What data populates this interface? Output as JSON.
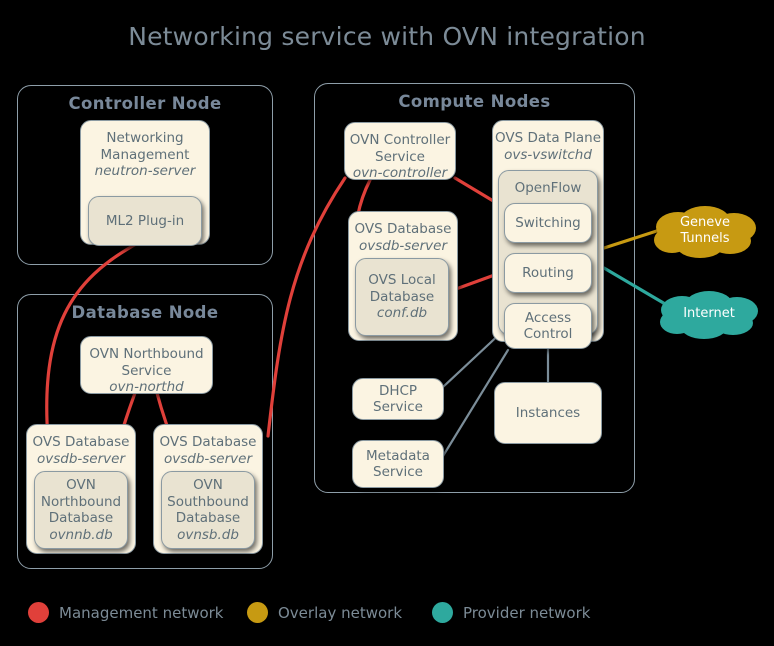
{
  "title": "Networking service with OVN integration",
  "colors": {
    "background": "#000000",
    "title_text": "#7c8b97",
    "group_border": "#8e9ea9",
    "box_fill": "#fbf4e2",
    "box_fill_nested": "#e9e3d1",
    "box_border": "#8b9aa2",
    "box_text": "#5f7079",
    "management_network": "#e0403a",
    "overlay_network": "#c79a12",
    "provider_network": "#2ea99e",
    "plain_link": "#7b8d99"
  },
  "groups": [
    {
      "id": "controller-node",
      "title": "Controller Node"
    },
    {
      "id": "database-node",
      "title": "Database Node"
    },
    {
      "id": "compute-nodes",
      "title": "Compute Nodes"
    }
  ],
  "boxes": {
    "networking_management": {
      "line1": "Networking",
      "line2": "Management",
      "line3": "neutron-server"
    },
    "ml2_plugin": {
      "line1": "ML2 Plug-in"
    },
    "ovn_northbound_service": {
      "line1": "OVN Northbound",
      "line2": "Service",
      "line3": "ovn-northd"
    },
    "ovsdb_nb": {
      "line1": "OVS Database",
      "line2": "ovsdb-server"
    },
    "ovsdb_sb": {
      "line1": "OVS Database",
      "line2": "ovsdb-server"
    },
    "ovn_nb_database": {
      "line1": "OVN",
      "line2": "Northbound",
      "line3": "Database",
      "line4": "ovnnb.db"
    },
    "ovn_sb_database": {
      "line1": "OVN",
      "line2": "Southbound",
      "line3": "Database",
      "line4": "ovnsb.db"
    },
    "ovn_controller_service": {
      "line1": "OVN Controller",
      "line2": "Service",
      "line3": "ovn-controller"
    },
    "ovsdb_local": {
      "line1": "OVS Database",
      "line2": "ovsdb-server"
    },
    "ovs_local_database": {
      "line1": "OVS Local",
      "line2": "Database",
      "line3": "conf.db"
    },
    "ovs_data_plane": {
      "line1": "OVS Data Plane",
      "line2": "ovs-vswitchd"
    },
    "openflow": {
      "line1": "OpenFlow"
    },
    "switching": {
      "line1": "Switching"
    },
    "routing": {
      "line1": "Routing"
    },
    "access_control": {
      "line1": "Access",
      "line2": "Control"
    },
    "dhcp_service": {
      "line1": "DHCP Service"
    },
    "metadata_service": {
      "line1": "Metadata",
      "line2": "Service"
    },
    "instances": {
      "line1": "Instances"
    }
  },
  "clouds": {
    "geneve_tunnels": {
      "line1": "Geneve",
      "line2": "Tunnels",
      "color": "#c79a12"
    },
    "internet": {
      "line1": "Internet",
      "color": "#2ea99e"
    }
  },
  "legend": [
    {
      "label": "Management network",
      "color": "#e0403a"
    },
    {
      "label": "Overlay network",
      "color": "#c79a12"
    },
    {
      "label": "Provider network",
      "color": "#2ea99e"
    }
  ]
}
